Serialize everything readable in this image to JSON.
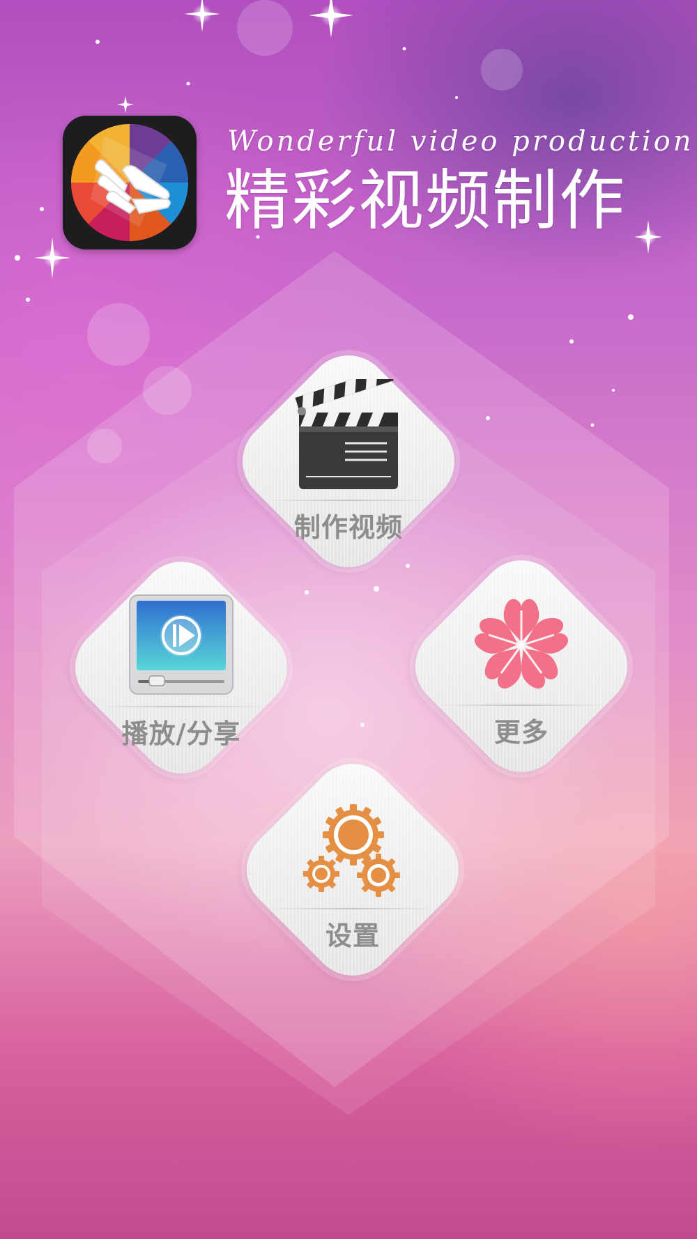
{
  "header": {
    "slogan_en": "Wonderful video production",
    "slogan_cn": "精彩视频制作"
  },
  "menu": {
    "make_video": {
      "label": "制作视频",
      "icon": "clapperboard-icon"
    },
    "play_share": {
      "label": "播放/分享",
      "icon": "video-player-icon"
    },
    "more": {
      "label": "更多",
      "icon": "flower-icon"
    },
    "settings": {
      "label": "设置",
      "icon": "gears-icon"
    }
  },
  "colors": {
    "tile_label": "#8d8d8d",
    "gear": "#e58f45",
    "flower": "#f27189",
    "player_screen": "#33a9d6"
  }
}
